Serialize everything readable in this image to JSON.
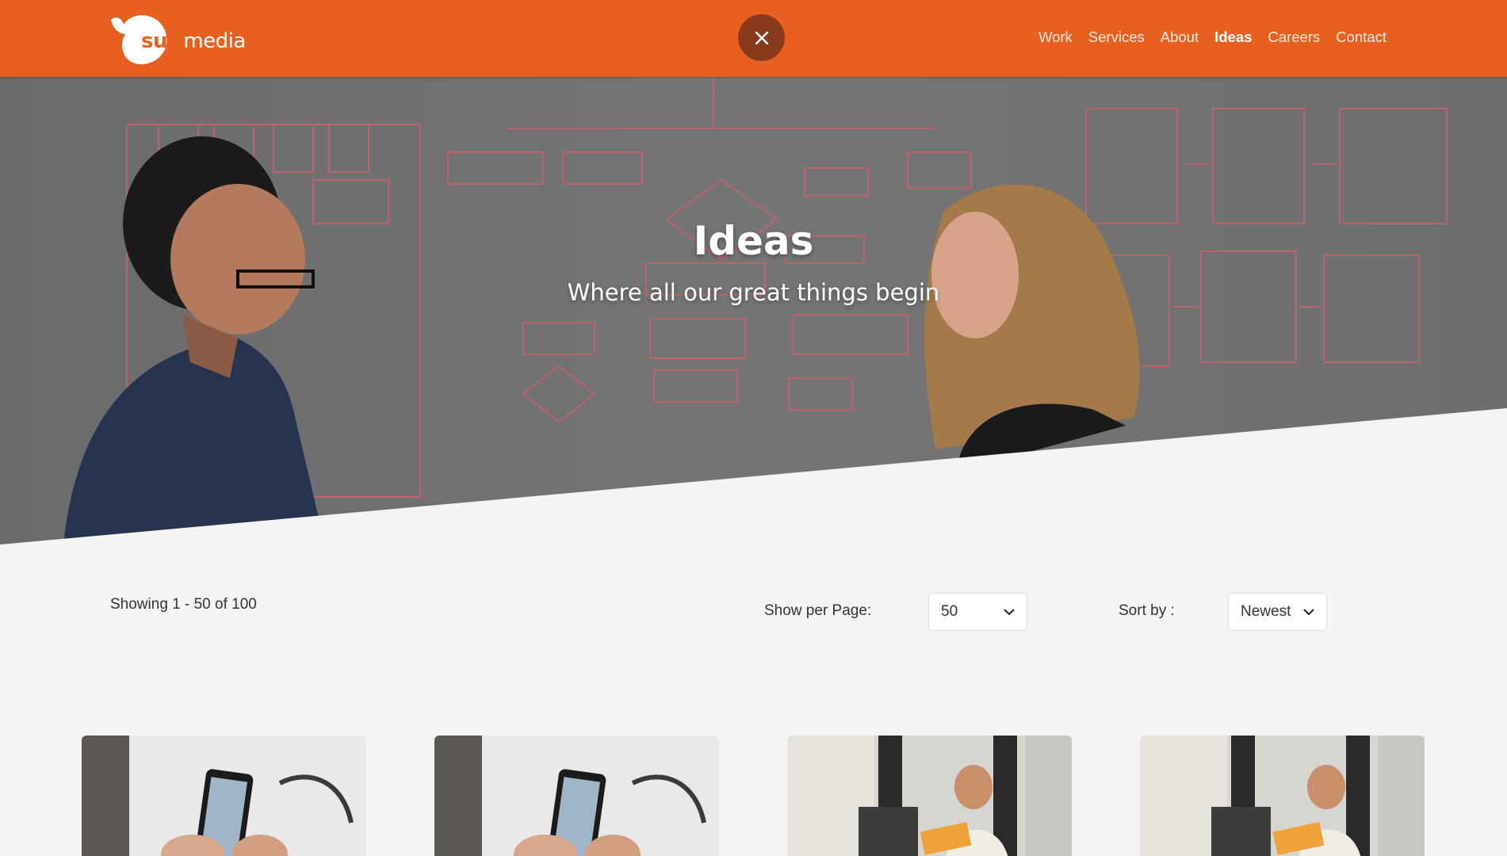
{
  "header": {
    "logo_text_bold": "suit",
    "logo_text_light": "media",
    "nav": [
      {
        "label": "Work",
        "active": false
      },
      {
        "label": "Services",
        "active": false
      },
      {
        "label": "About",
        "active": false
      },
      {
        "label": "Ideas",
        "active": true
      },
      {
        "label": "Careers",
        "active": false
      },
      {
        "label": "Contact",
        "active": false
      }
    ],
    "close_icon": "close-icon"
  },
  "hero": {
    "title": "Ideas",
    "subtitle": "Where all our great things begin"
  },
  "toolbar": {
    "showing": "Showing 1 - 50 of 100",
    "per_page_label": "Show per Page:",
    "per_page_value": "50",
    "sort_label": "Sort by :",
    "sort_value": "Newest"
  },
  "cards": [
    {
      "image": "phone-in-hands-photo"
    },
    {
      "image": "phone-in-hands-photo"
    },
    {
      "image": "man-reading-at-desk-photo"
    },
    {
      "image": "man-reading-at-desk-photo"
    }
  ],
  "colors": {
    "brand": "#e8601f",
    "close_button": "#8a3a1c",
    "page_bg": "#f4f4f4"
  }
}
